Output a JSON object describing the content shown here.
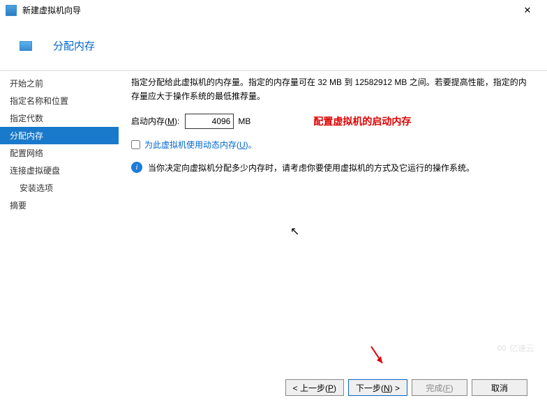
{
  "titlebar": {
    "title": "新建虚拟机向导",
    "close": "✕"
  },
  "header": {
    "title": "分配内存"
  },
  "sidebar": {
    "items": [
      {
        "label": "开始之前"
      },
      {
        "label": "指定名称和位置"
      },
      {
        "label": "指定代数"
      },
      {
        "label": "分配内存",
        "active": true
      },
      {
        "label": "配置网络"
      },
      {
        "label": "连接虚拟硬盘"
      },
      {
        "label": "安装选项",
        "sub": true
      },
      {
        "label": "摘要"
      }
    ]
  },
  "content": {
    "description": "指定分配给此虚拟机的内存量。指定的内存量可在 32 MB 到 12582912 MB 之间。若要提高性能，指定的内存量应大于操作系统的最低推荐量。",
    "mem_label_pre": "启动内存(",
    "mem_label_hot": "M",
    "mem_label_post": "):",
    "mem_value": "4096",
    "mem_unit": "MB",
    "annotation": "配置虚拟机的启动内存",
    "chk_pre": "为此虚拟机使用动态内存(",
    "chk_hot": "U",
    "chk_post": ")。",
    "info": "当你决定向虚拟机分配多少内存时，请考虑你要使用虚拟机的方式及它运行的操作系统。"
  },
  "footer": {
    "prev_pre": "< 上一步(",
    "prev_hot": "P",
    "prev_post": ")",
    "next_pre": "下一步(",
    "next_hot": "N",
    "next_post": ") >",
    "finish_pre": "完成(",
    "finish_hot": "F",
    "finish_post": ")",
    "cancel": "取消"
  },
  "watermark": {
    "logo": "∞",
    "text": "亿速云"
  }
}
